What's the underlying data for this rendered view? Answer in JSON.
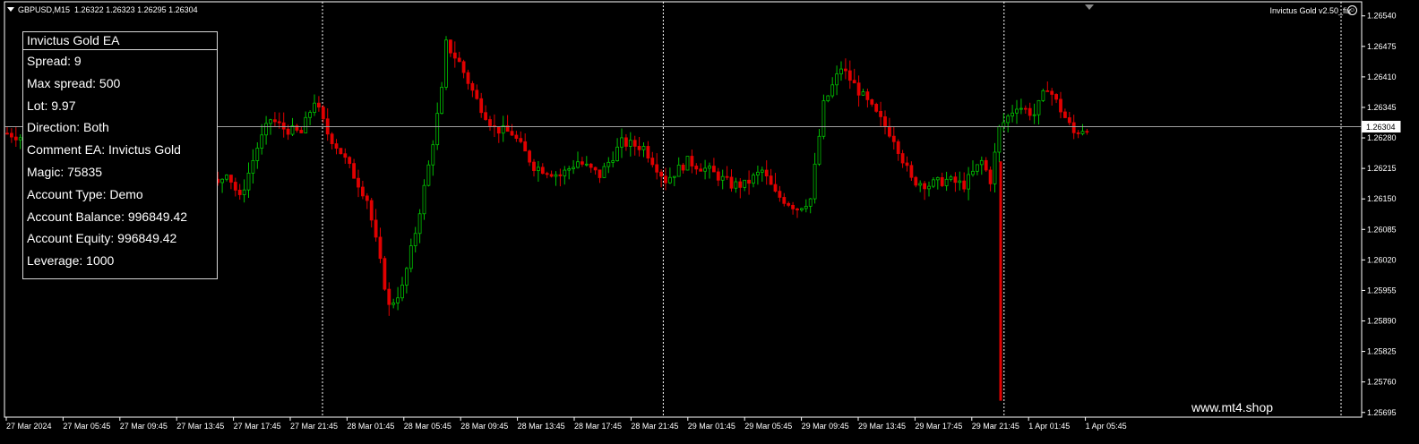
{
  "header": {
    "symbol": "GBPUSD,M15",
    "ohlc": "1.26322 1.26323 1.26295 1.26304"
  },
  "ea_label": "Invictus Gold v2.50_fix",
  "panel": {
    "title": "Invictus Gold EA",
    "rows": [
      "Spread: 9",
      "Max spread: 500",
      "Lot: 9.97",
      "Direction: Both",
      "Comment EA: Invictus Gold",
      "Magic: 75835",
      "Account Type: Demo",
      "Account Balance: 996849.42",
      "Account Equity: 996849.42",
      "Leverage: 1000"
    ]
  },
  "watermark": "www.mt4.shop",
  "colors": {
    "background": "#000000",
    "bull": "#00c000",
    "bear": "#e00000",
    "grid": "#ffffff",
    "price_line": "#a0a0a0",
    "text": "#ffffff"
  },
  "chart_data": {
    "type": "candlestick",
    "current_price": "1.26304",
    "y_ticks": [
      "1.26540",
      "1.26475",
      "1.26410",
      "1.26345",
      "1.26280",
      "1.26215",
      "1.26150",
      "1.26085",
      "1.26020",
      "1.25955",
      "1.25890",
      "1.25825",
      "1.25760",
      "1.25695"
    ],
    "ylim": [
      1.25685,
      1.2657
    ],
    "x_ticks": [
      "27 Mar 2024",
      "27 Mar 05:45",
      "27 Mar 09:45",
      "27 Mar 13:45",
      "27 Mar 17:45",
      "27 Mar 21:45",
      "28 Mar 01:45",
      "28 Mar 05:45",
      "28 Mar 09:45",
      "28 Mar 13:45",
      "28 Mar 17:45",
      "28 Mar 21:45",
      "29 Mar 01:45",
      "29 Mar 05:45",
      "29 Mar 09:45",
      "29 Mar 13:45",
      "29 Mar 17:45",
      "29 Mar 21:45",
      "1 Apr 01:45",
      "1 Apr 05:45"
    ],
    "session_separators": [
      "27 Mar 21:45",
      "28 Mar 21:45",
      "29 Mar 21:45"
    ],
    "path": [
      [
        0,
        1.2629
      ],
      [
        8,
        1.2627
      ],
      [
        15,
        1.2617
      ],
      [
        20,
        1.2624
      ],
      [
        25,
        1.263
      ],
      [
        30,
        1.2636
      ],
      [
        35,
        1.26395
      ],
      [
        38,
        1.26385
      ],
      [
        42,
        1.2636
      ],
      [
        45,
        1.262
      ],
      [
        48,
        1.2618
      ],
      [
        50,
        1.2621
      ],
      [
        53,
        1.2615
      ],
      [
        57,
        1.2626
      ],
      [
        60,
        1.2632
      ],
      [
        63,
        1.263
      ],
      [
        67,
        1.2629
      ],
      [
        70,
        1.2636
      ],
      [
        73,
        1.2629
      ],
      [
        76,
        1.2625
      ],
      [
        79,
        1.262
      ],
      [
        82,
        1.2615
      ],
      [
        84,
        1.2606
      ],
      [
        87,
        1.2592
      ],
      [
        90,
        1.2596
      ],
      [
        93,
        1.2608
      ],
      [
        96,
        1.2622
      ],
      [
        99,
        1.2638
      ],
      [
        100,
        1.2648
      ],
      [
        103,
        1.2644
      ],
      [
        107,
        1.2636
      ],
      [
        111,
        1.263
      ],
      [
        115,
        1.2629
      ],
      [
        120,
        1.2622
      ],
      [
        126,
        1.262
      ],
      [
        130,
        1.2623
      ],
      [
        135,
        1.262
      ],
      [
        140,
        1.2627
      ],
      [
        145,
        1.2626
      ],
      [
        150,
        1.2619
      ],
      [
        155,
        1.2623
      ],
      [
        160,
        1.2621
      ],
      [
        165,
        1.2618
      ],
      [
        168,
        1.2618
      ],
      [
        172,
        1.2621
      ],
      [
        175,
        1.2616
      ],
      [
        180,
        1.2613
      ],
      [
        183,
        1.2615
      ],
      [
        186,
        1.2635
      ],
      [
        190,
        1.2643
      ],
      [
        194,
        1.2638
      ],
      [
        198,
        1.2633
      ],
      [
        202,
        1.2628
      ],
      [
        206,
        1.2619
      ],
      [
        210,
        1.2618
      ],
      [
        214,
        1.2619
      ],
      [
        218,
        1.2618
      ],
      [
        222,
        1.2623
      ],
      [
        224,
        1.2619
      ],
      [
        226,
        1.263
      ],
      [
        230,
        1.2635
      ],
      [
        234,
        1.2633
      ],
      [
        237,
        1.2639
      ],
      [
        240,
        1.2634
      ],
      [
        243,
        1.2629
      ],
      [
        246,
        1.26304
      ]
    ]
  }
}
